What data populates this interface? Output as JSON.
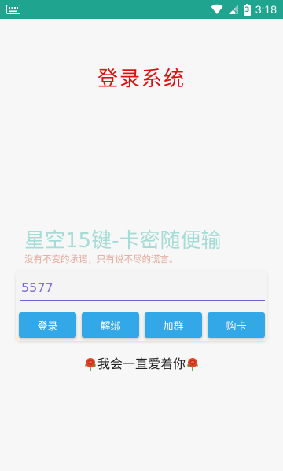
{
  "status_bar": {
    "time": "3:18",
    "battery_level": "3",
    "icons": [
      "keyboard-icon",
      "wifi-icon",
      "signal-icon",
      "battery-icon"
    ],
    "background": "#1fa58f"
  },
  "header": {
    "title": "登录系统",
    "title_color": "#e01010"
  },
  "brand": {
    "title": "星空15键-卡密随便输",
    "subtitle": "没有不变的承诺，只有说不尽的谎言。"
  },
  "form": {
    "code_value": "5577",
    "underline_color": "#6c63d8"
  },
  "buttons": {
    "login": "登录",
    "unbind": "解绑",
    "join_group": "加群",
    "buy_card": "购卡",
    "color": "#33a8e8"
  },
  "footer": {
    "motto": "我会一直爱着你",
    "icon": "rose-icon"
  }
}
